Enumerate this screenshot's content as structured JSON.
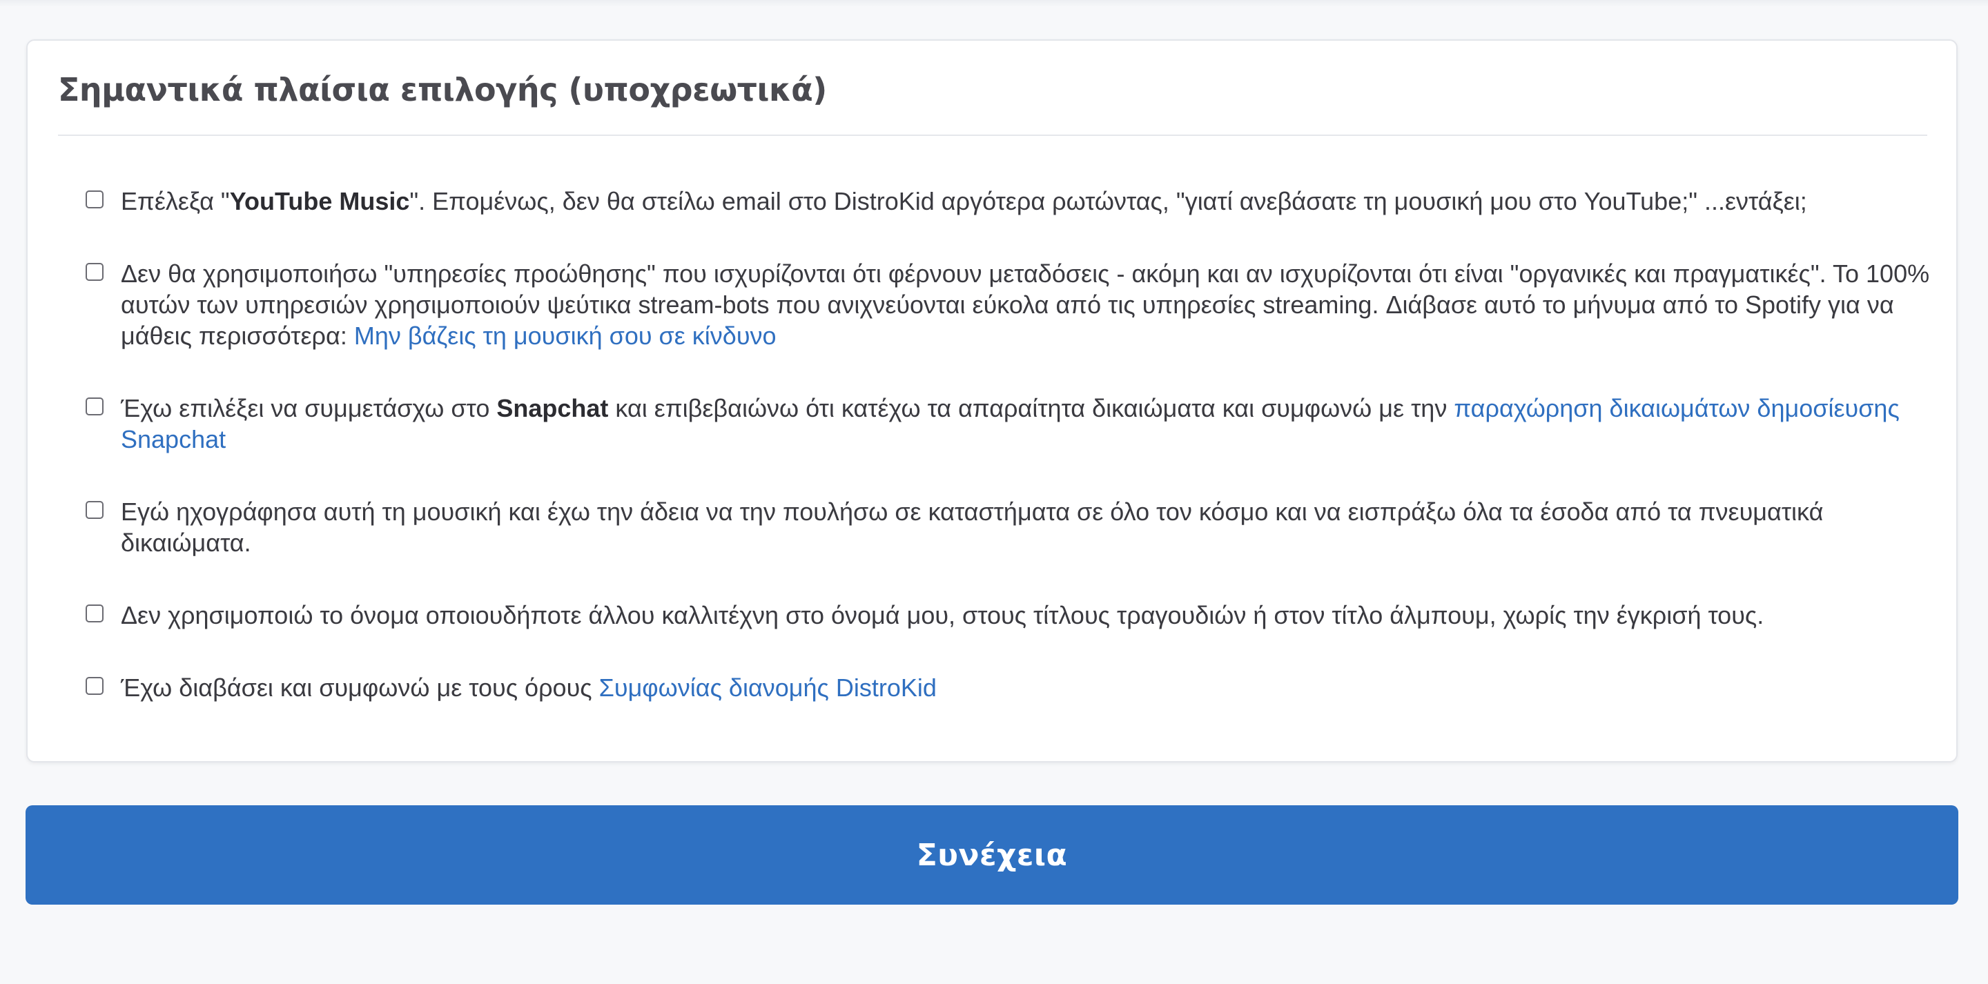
{
  "card": {
    "title": "Σημαντικά πλαίσια επιλογής (υποχρεωτικά)"
  },
  "options": [
    {
      "t1": "Επέλεξα \"",
      "bold": "YouTube Music",
      "t2": "\". Επομένως, δεν θα στείλω email στο DistroKid αργότερα ρωτώντας, \"γιατί ανεβάσατε τη μουσική μου στο YouTube;\" ...εντάξει;"
    },
    {
      "t1": "Δεν θα χρησιμοποιήσω \"υπηρεσίες προώθησης\" που ισχυρίζονται ότι φέρνουν μεταδόσεις - ακόμη και αν ισχυρίζονται ότι είναι \"οργανικές και πραγματικές\". Το 100% αυτών των υπηρεσιών χρησιμοποιούν ψεύτικα stream-bots που ανιχνεύονται εύκολα από τις υπηρεσίες streaming. Διάβασε αυτό το μήνυμα από το Spotify για να μάθεις περισσότερα: ",
      "link": "Μην βάζεις τη μουσική σου σε κίνδυνο"
    },
    {
      "t1": "Έχω επιλέξει να συμμετάσχω στο ",
      "bold": "Snapchat",
      "t2": " και επιβεβαιώνω ότι κατέχω τα απαραίτητα δικαιώματα και συμφωνώ με την ",
      "link": "παραχώρηση δικαιωμάτων δημοσίευσης Snapchat"
    },
    {
      "t1": "Εγώ ηχογράφησα αυτή τη μουσική και έχω την άδεια να την πουλήσω σε καταστήματα σε όλο τον κόσμο και να εισπράξω όλα τα έσοδα από τα πνευματικά δικαιώματα."
    },
    {
      "t1": "Δεν χρησιμοποιώ το όνομα οποιουδήποτε άλλου καλλιτέχνη στο όνομά μου, στους τίτλους τραγουδιών ή στον τίτλο άλμπουμ, χωρίς την έγκρισή τους."
    },
    {
      "t1": "Έχω διαβάσει και συμφωνώ με τους όρους ",
      "link": "Συμφωνίας διανομής DistroKid"
    }
  ],
  "continue_button": {
    "label": "Συνέχεια"
  },
  "colors": {
    "accent": "#2f71c2",
    "link": "#2f6fc0",
    "background": "#f7f8fa"
  }
}
